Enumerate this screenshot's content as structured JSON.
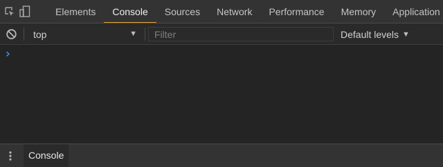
{
  "toolbar": {
    "inspect_icon": "inspect-element-icon",
    "device_icon": "device-toolbar-icon"
  },
  "tabs": [
    {
      "label": "Elements",
      "active": false
    },
    {
      "label": "Console",
      "active": true
    },
    {
      "label": "Sources",
      "active": false
    },
    {
      "label": "Network",
      "active": false
    },
    {
      "label": "Performance",
      "active": false
    },
    {
      "label": "Memory",
      "active": false
    },
    {
      "label": "Application",
      "active": false
    }
  ],
  "console_toolbar": {
    "clear_icon": "clear-console-icon",
    "context": "top",
    "context_arrow": "▼",
    "filter_placeholder": "Filter",
    "filter_value": "",
    "levels_label": "Default levels",
    "levels_arrow": "▼"
  },
  "console": {
    "prompt_icon": "chevron-right-icon"
  },
  "drawer": {
    "menu_icon": "more-vertical-icon",
    "tab_label": "Console"
  },
  "colors": {
    "accent": "#e8a234",
    "background": "#242424",
    "toolbar": "#333333",
    "prompt": "#3b86e6"
  }
}
